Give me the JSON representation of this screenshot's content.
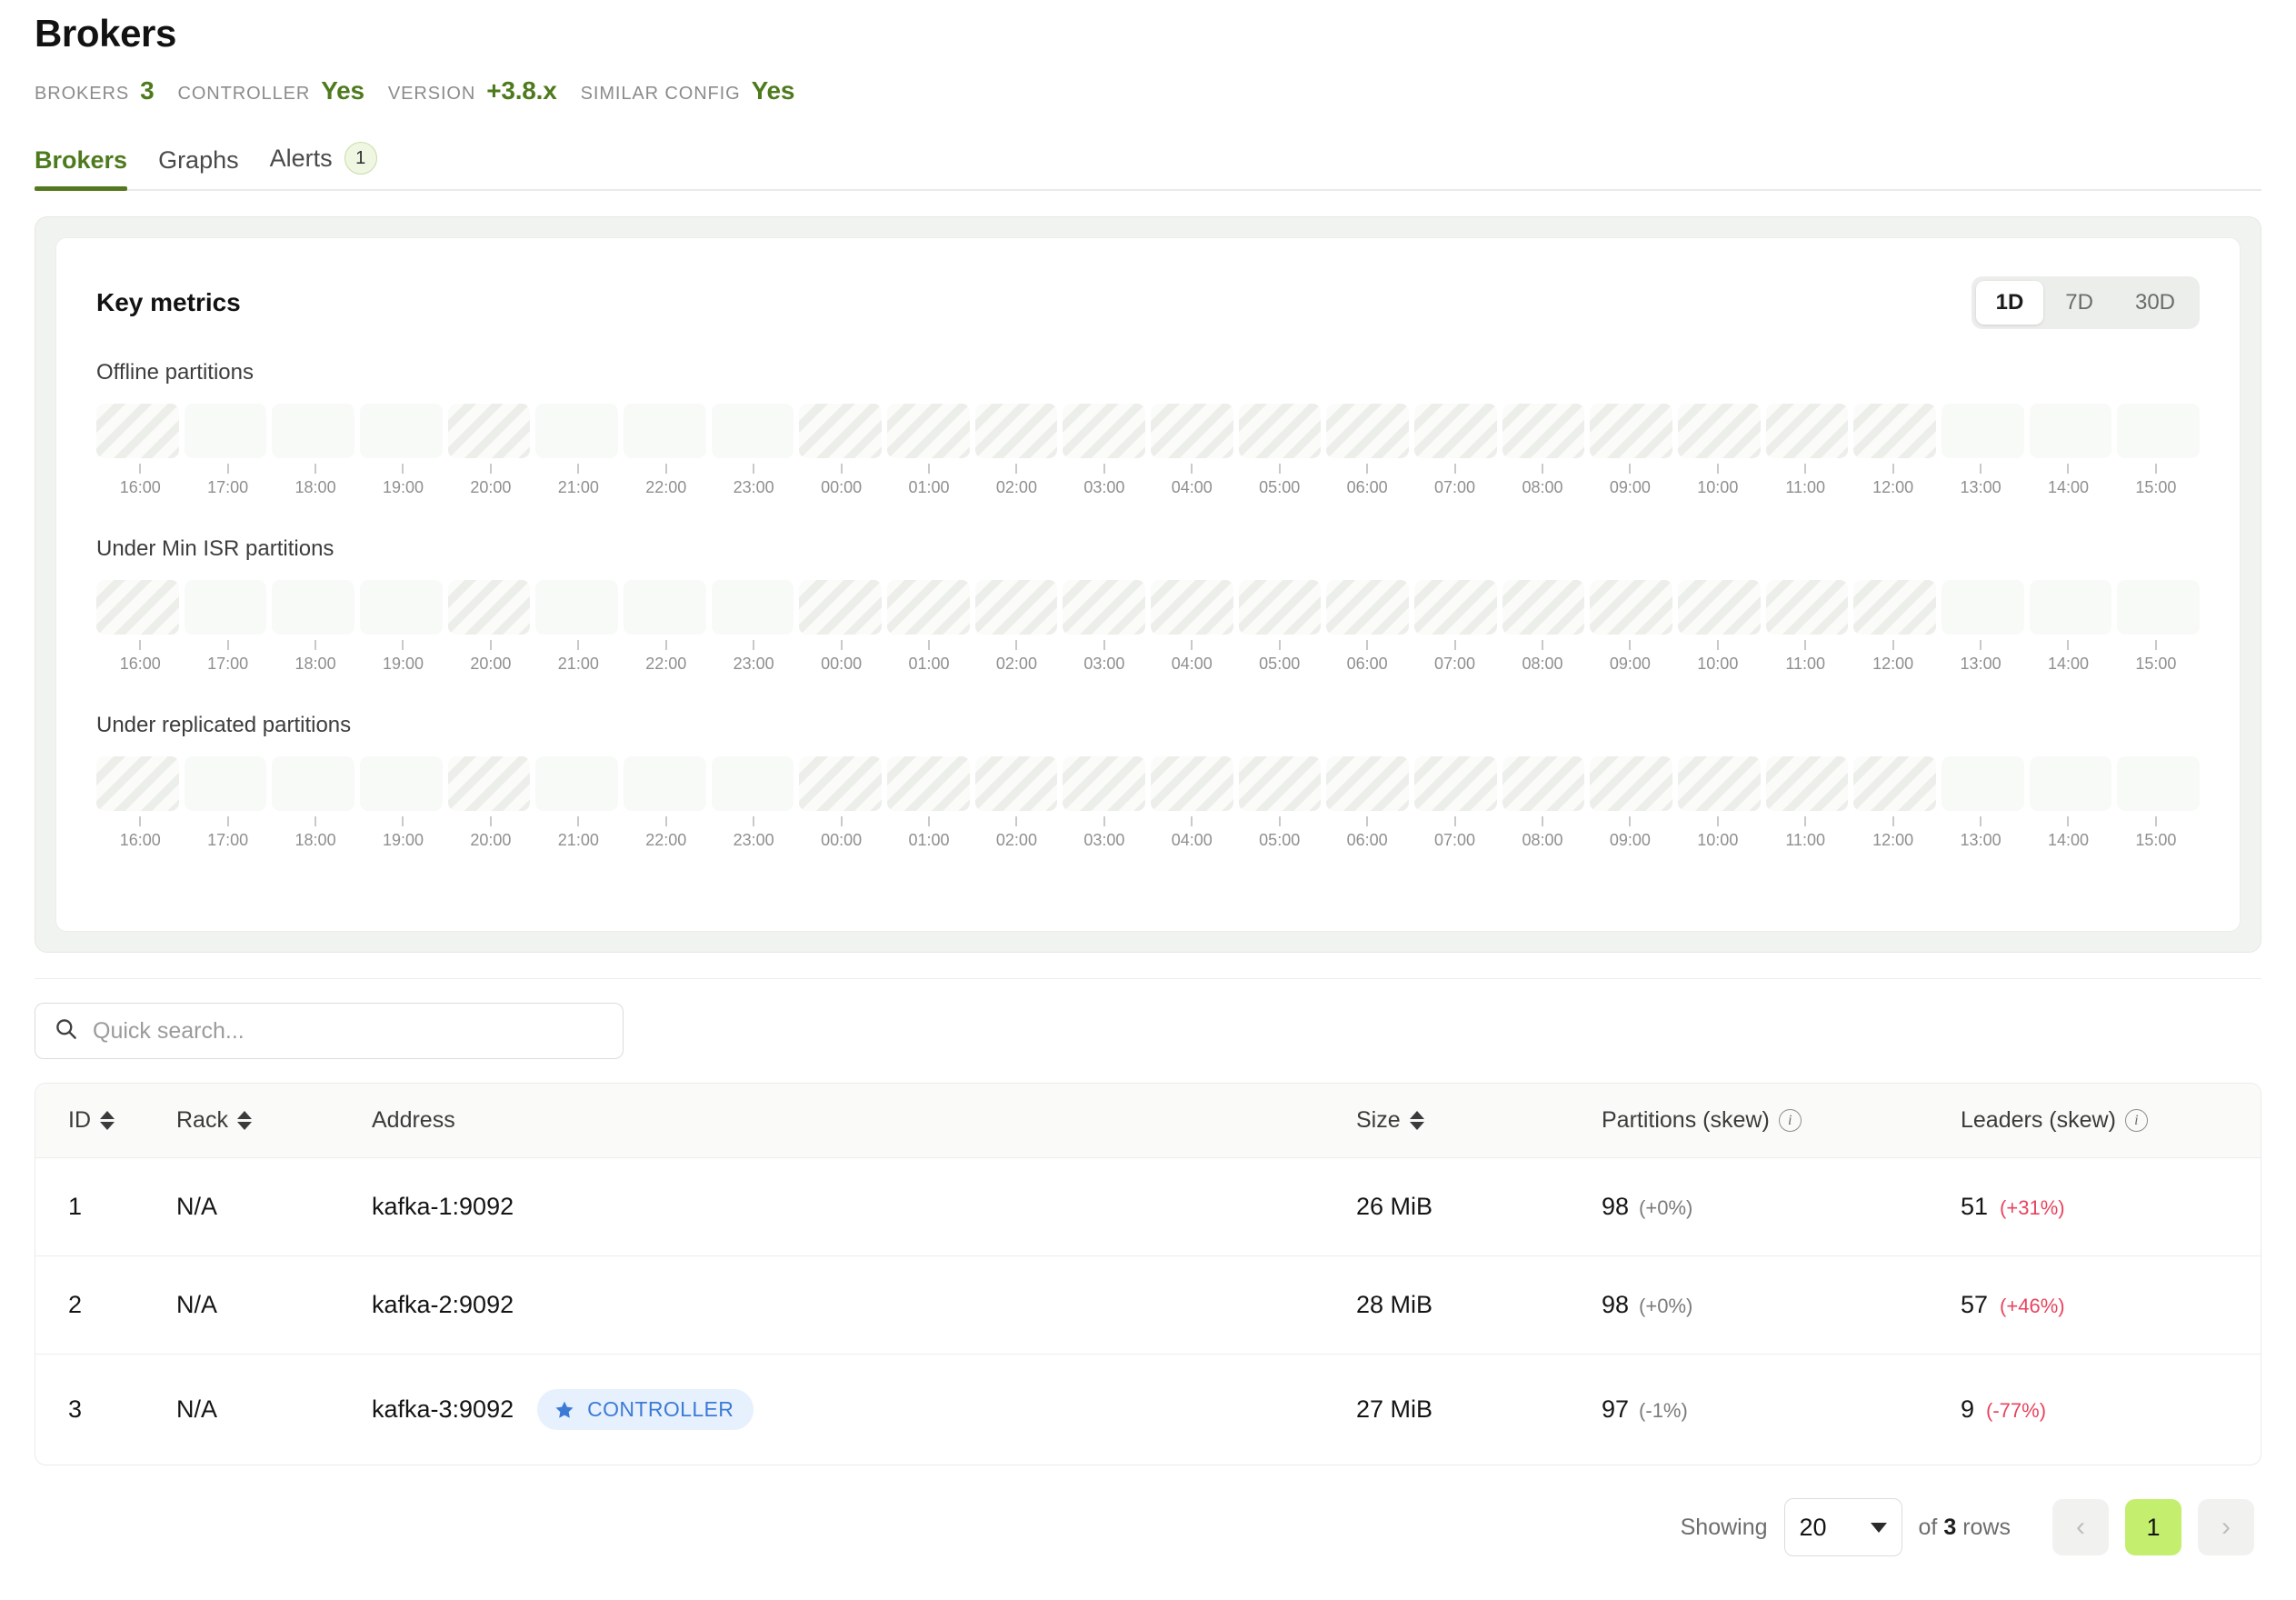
{
  "header": {
    "title": "Brokers",
    "stats": [
      {
        "label": "BROKERS",
        "value": "3"
      },
      {
        "label": "CONTROLLER",
        "value": "Yes"
      },
      {
        "label": "VERSION",
        "value": "+3.8.x"
      },
      {
        "label": "SIMILAR CONFIG",
        "value": "Yes"
      }
    ]
  },
  "tabs": [
    {
      "label": "Brokers",
      "active": true,
      "badge": null
    },
    {
      "label": "Graphs",
      "active": false,
      "badge": null
    },
    {
      "label": "Alerts",
      "active": false,
      "badge": "1"
    }
  ],
  "metrics": {
    "title": "Key metrics",
    "ranges": [
      {
        "label": "1D",
        "active": true
      },
      {
        "label": "7D",
        "active": false
      },
      {
        "label": "30D",
        "active": false
      }
    ]
  },
  "chart_data": [
    {
      "type": "heatmap",
      "title": "Offline partitions",
      "xlabel": "",
      "ylabel": "",
      "grid": false,
      "legend": "none",
      "categories": [
        "16:00",
        "17:00",
        "18:00",
        "19:00",
        "20:00",
        "21:00",
        "22:00",
        "23:00",
        "00:00",
        "01:00",
        "02:00",
        "03:00",
        "04:00",
        "05:00",
        "06:00",
        "07:00",
        "08:00",
        "09:00",
        "10:00",
        "11:00",
        "12:00",
        "13:00",
        "14:00",
        "15:00"
      ],
      "values": [
        null,
        0,
        0,
        0,
        null,
        0,
        0,
        0,
        null,
        null,
        null,
        null,
        null,
        null,
        null,
        null,
        null,
        null,
        null,
        null,
        null,
        0,
        0,
        0
      ],
      "cell_states": [
        "no-data",
        "empty",
        "empty",
        "empty",
        "no-data",
        "empty",
        "empty",
        "empty",
        "no-data",
        "no-data",
        "no-data",
        "no-data",
        "no-data",
        "no-data",
        "no-data",
        "no-data",
        "no-data",
        "no-data",
        "no-data",
        "no-data",
        "no-data",
        "empty",
        "empty",
        "empty"
      ]
    },
    {
      "type": "heatmap",
      "title": "Under Min ISR partitions",
      "xlabel": "",
      "ylabel": "",
      "grid": false,
      "legend": "none",
      "categories": [
        "16:00",
        "17:00",
        "18:00",
        "19:00",
        "20:00",
        "21:00",
        "22:00",
        "23:00",
        "00:00",
        "01:00",
        "02:00",
        "03:00",
        "04:00",
        "05:00",
        "06:00",
        "07:00",
        "08:00",
        "09:00",
        "10:00",
        "11:00",
        "12:00",
        "13:00",
        "14:00",
        "15:00"
      ],
      "values": [
        null,
        0,
        0,
        0,
        null,
        0,
        0,
        0,
        null,
        null,
        null,
        null,
        null,
        null,
        null,
        null,
        null,
        null,
        null,
        null,
        null,
        0,
        0,
        0
      ],
      "cell_states": [
        "no-data",
        "empty",
        "empty",
        "empty",
        "no-data",
        "empty",
        "empty",
        "empty",
        "no-data",
        "no-data",
        "no-data",
        "no-data",
        "no-data",
        "no-data",
        "no-data",
        "no-data",
        "no-data",
        "no-data",
        "no-data",
        "no-data",
        "no-data",
        "empty",
        "empty",
        "empty"
      ]
    },
    {
      "type": "heatmap",
      "title": "Under replicated partitions",
      "xlabel": "",
      "ylabel": "",
      "grid": false,
      "legend": "none",
      "categories": [
        "16:00",
        "17:00",
        "18:00",
        "19:00",
        "20:00",
        "21:00",
        "22:00",
        "23:00",
        "00:00",
        "01:00",
        "02:00",
        "03:00",
        "04:00",
        "05:00",
        "06:00",
        "07:00",
        "08:00",
        "09:00",
        "10:00",
        "11:00",
        "12:00",
        "13:00",
        "14:00",
        "15:00"
      ],
      "values": [
        null,
        0,
        0,
        0,
        null,
        0,
        0,
        0,
        null,
        null,
        null,
        null,
        null,
        null,
        null,
        null,
        null,
        null,
        null,
        null,
        null,
        0,
        0,
        0
      ],
      "cell_states": [
        "no-data",
        "empty",
        "empty",
        "empty",
        "no-data",
        "empty",
        "empty",
        "empty",
        "no-data",
        "no-data",
        "no-data",
        "no-data",
        "no-data",
        "no-data",
        "no-data",
        "no-data",
        "no-data",
        "no-data",
        "no-data",
        "no-data",
        "no-data",
        "empty",
        "empty",
        "empty"
      ]
    }
  ],
  "search": {
    "placeholder": "Quick search...",
    "value": ""
  },
  "table": {
    "columns": [
      {
        "key": "id",
        "label": "ID",
        "sortable": true,
        "info": false
      },
      {
        "key": "rack",
        "label": "Rack",
        "sortable": true,
        "info": false
      },
      {
        "key": "address",
        "label": "Address",
        "sortable": false,
        "info": false
      },
      {
        "key": "size",
        "label": "Size",
        "sortable": true,
        "info": false
      },
      {
        "key": "partitions",
        "label": "Partitions (skew)",
        "sortable": false,
        "info": true
      },
      {
        "key": "leaders",
        "label": "Leaders (skew)",
        "sortable": false,
        "info": true
      }
    ],
    "rows": [
      {
        "id": "1",
        "rack": "N/A",
        "address": "kafka-1:9092",
        "badge": null,
        "size": "26 MiB",
        "partitions": "98",
        "partitions_skew": "(+0%)",
        "partitions_skew_alert": false,
        "leaders": "51",
        "leaders_skew": "(+31%)",
        "leaders_skew_alert": true
      },
      {
        "id": "2",
        "rack": "N/A",
        "address": "kafka-2:9092",
        "badge": null,
        "size": "28 MiB",
        "partitions": "98",
        "partitions_skew": "(+0%)",
        "partitions_skew_alert": false,
        "leaders": "57",
        "leaders_skew": "(+46%)",
        "leaders_skew_alert": true
      },
      {
        "id": "3",
        "rack": "N/A",
        "address": "kafka-3:9092",
        "badge": "CONTROLLER",
        "size": "27 MiB",
        "partitions": "97",
        "partitions_skew": "(-1%)",
        "partitions_skew_alert": false,
        "leaders": "9",
        "leaders_skew": "(-77%)",
        "leaders_skew_alert": true
      }
    ]
  },
  "pagination": {
    "showing_label": "Showing",
    "page_size": "20",
    "of_label": "of",
    "row_count": "3",
    "rows_label": "rows",
    "prev_icon": "chevron-left",
    "next_icon": "chevron-right",
    "current_page": "1"
  },
  "colors": {
    "accent_green": "#4e7a1e",
    "tab_underline": "#54781f",
    "badge_blue": "#3c7ad6",
    "badge_blue_bg": "#e7f1fd",
    "alert_red": "#e8445e",
    "pager_active": "#c4ee6d"
  }
}
